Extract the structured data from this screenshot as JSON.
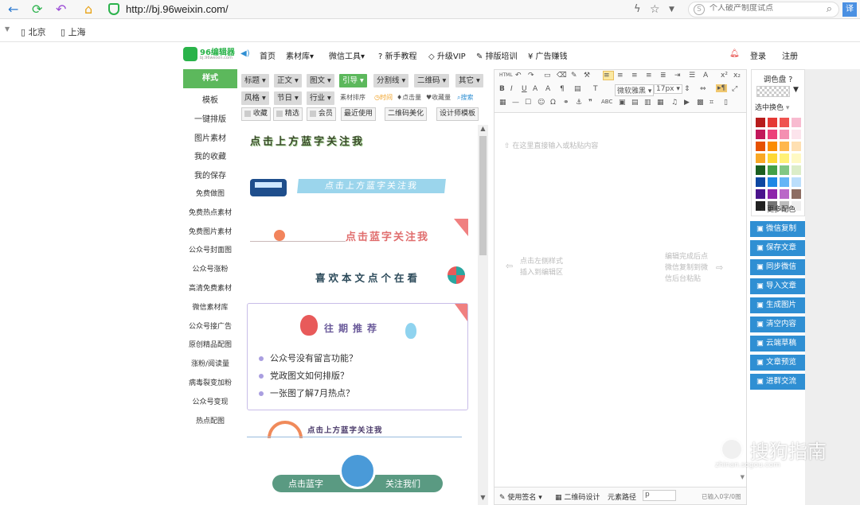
{
  "browser": {
    "url": "http://bj.96weixin.com/",
    "search_placeholder": "个人破产制度试点",
    "bookmarks": [
      "北京",
      "上海"
    ]
  },
  "site": {
    "logo_text": "96编辑器",
    "logo_sub": "bj.96weixin.com",
    "nav": [
      "首页",
      "素材库",
      "微信工具",
      "新手教程",
      "升级VIP",
      "排版培训",
      "广告赚钱"
    ],
    "login": "登录",
    "register": "注册"
  },
  "left_menu": {
    "active": "样式",
    "items": [
      "模板",
      "一键排版",
      "图片素材",
      "我的收藏",
      "我的保存",
      "免费做图",
      "免费热点素材",
      "免费图片素材",
      "公众号封面图",
      "公众号涨粉",
      "高清免费素材",
      "微信素材库",
      "公众号接广告",
      "原创精品配图",
      "涨粉/阅读量",
      "病毒裂变加粉",
      "公众号变现",
      "热点配图"
    ]
  },
  "style_tags": {
    "row1": [
      "标题",
      "正文",
      "图文",
      "引导",
      "分割线",
      "二维码",
      "其它"
    ],
    "row2": [
      "风格",
      "节日",
      "行业"
    ],
    "sort_label": "素材排序",
    "sort_time": "时间",
    "sort_clicks": "点击量",
    "sort_favs": "收藏量",
    "search": "搜索",
    "row3_checks": [
      "收藏",
      "精选",
      "会员"
    ],
    "row3_buttons": [
      "最近使用",
      "二维码美化",
      "设计师模板"
    ]
  },
  "style_items": {
    "s1": "点击上方蓝字关注我",
    "s2": "点击上方蓝字关注我",
    "s3": "点击蓝字关注我",
    "s4": "喜欢本文点个在看",
    "s5_title": "往期推荐",
    "s5_list": [
      "公众号没有留言功能？",
      "党政图文如何排版？",
      "一张图了解7月热点？"
    ],
    "s6": "点击上方蓝字关注我",
    "s7_left": "点击蓝字",
    "s7_right": "关注我们"
  },
  "editor": {
    "placeholder": "在这里直接输入或粘贴内容",
    "hint_left_1": "点击左侧样式",
    "hint_left_2": "插入到编辑区",
    "hint_right_1": "编辑完成后点",
    "hint_right_2": "微信复制到微",
    "hint_right_3": "信后台粘贴",
    "font": "微软雅黑",
    "size": "17px",
    "status_sign": "使用签名",
    "status_qr": "二维码设计",
    "status_path_label": "元素路径",
    "status_path_value": "p",
    "status_count": "已输入0字/0图"
  },
  "palette": {
    "title": "调色盘",
    "select_label": "选中换色",
    "more": "更多配色",
    "colors": [
      "#b71c1c",
      "#e53935",
      "#ef5350",
      "#f8bbd0",
      "#c2185b",
      "#ec407a",
      "#f48fb1",
      "#fce4ec",
      "#e65100",
      "#fb8c00",
      "#ffb74d",
      "#ffe0b2",
      "#f9a825",
      "#fdd835",
      "#fff176",
      "#fff9c4",
      "#1b5e20",
      "#43a047",
      "#81c784",
      "#dcedc8",
      "#0d47a1",
      "#1e88e5",
      "#64b5f6",
      "#bbdefb",
      "#4a148c",
      "#8e24aa",
      "#ba68c8",
      "#8d6e63",
      "#212121",
      "#757575",
      "#bdbdbd",
      "#eeeeee"
    ]
  },
  "right_buttons": [
    "微信复制",
    "保存文章",
    "同步微信",
    "导入文章",
    "生成图片",
    "清空内容",
    "云端草稿",
    "文章预览",
    "进群交流"
  ],
  "watermark": {
    "text": "搜狗指南",
    "sub": "zhinan.sogou.com"
  },
  "colors": {
    "green": "#5cb85c",
    "blue": "#2f8fd3",
    "logo_green": "#2ab34a"
  }
}
